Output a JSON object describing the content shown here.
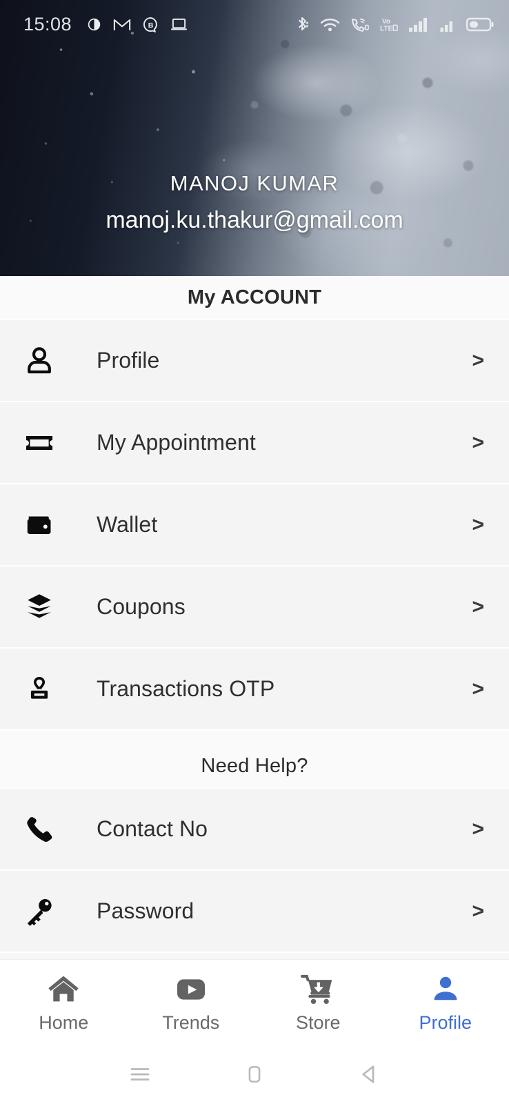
{
  "status_bar": {
    "time": "15:08",
    "left_icons": [
      "moon-phase-icon",
      "gmail-icon",
      "bolt-b-bubble-icon",
      "laptop-icon"
    ],
    "right_icons": [
      "bluetooth-icon",
      "wifi-icon",
      "wifi-calling-icon",
      "volte-icon",
      "signal-bars-icon-1",
      "signal-bars-icon-2",
      "battery-icon"
    ],
    "volte_label": "Vo\nLTE"
  },
  "header": {
    "name": "MANOJ KUMAR",
    "email": "manoj.ku.thakur@gmail.com"
  },
  "sections": [
    {
      "title": "My ACCOUNT",
      "items": [
        {
          "label": "Profile",
          "icon": "person-icon",
          "chevron": ">"
        },
        {
          "label": "My Appointment",
          "icon": "ticket-icon",
          "chevron": ">"
        },
        {
          "label": "Wallet",
          "icon": "wallet-icon",
          "chevron": ">"
        },
        {
          "label": "Coupons",
          "icon": "layers-icon",
          "chevron": ">"
        },
        {
          "label": "Transactions OTP",
          "icon": "stamp-icon",
          "chevron": ">"
        }
      ]
    },
    {
      "title": "Need Help?",
      "items": [
        {
          "label": "Contact No",
          "icon": "phone-icon",
          "chevron": ">"
        },
        {
          "label": "Password",
          "icon": "key-icon",
          "chevron": ">"
        }
      ]
    }
  ],
  "bottom_nav": {
    "active_index": 3,
    "active_color": "#3f6fd0",
    "inactive_color": "#636363",
    "items": [
      {
        "label": "Home",
        "icon": "home-icon"
      },
      {
        "label": "Trends",
        "icon": "play-video-icon"
      },
      {
        "label": "Store",
        "icon": "shopping-cart-download-icon"
      },
      {
        "label": "Profile",
        "icon": "person-filled-icon"
      }
    ]
  },
  "android_nav": {
    "buttons": [
      "recents-menu-icon",
      "home-square-icon",
      "back-triangle-icon"
    ]
  }
}
